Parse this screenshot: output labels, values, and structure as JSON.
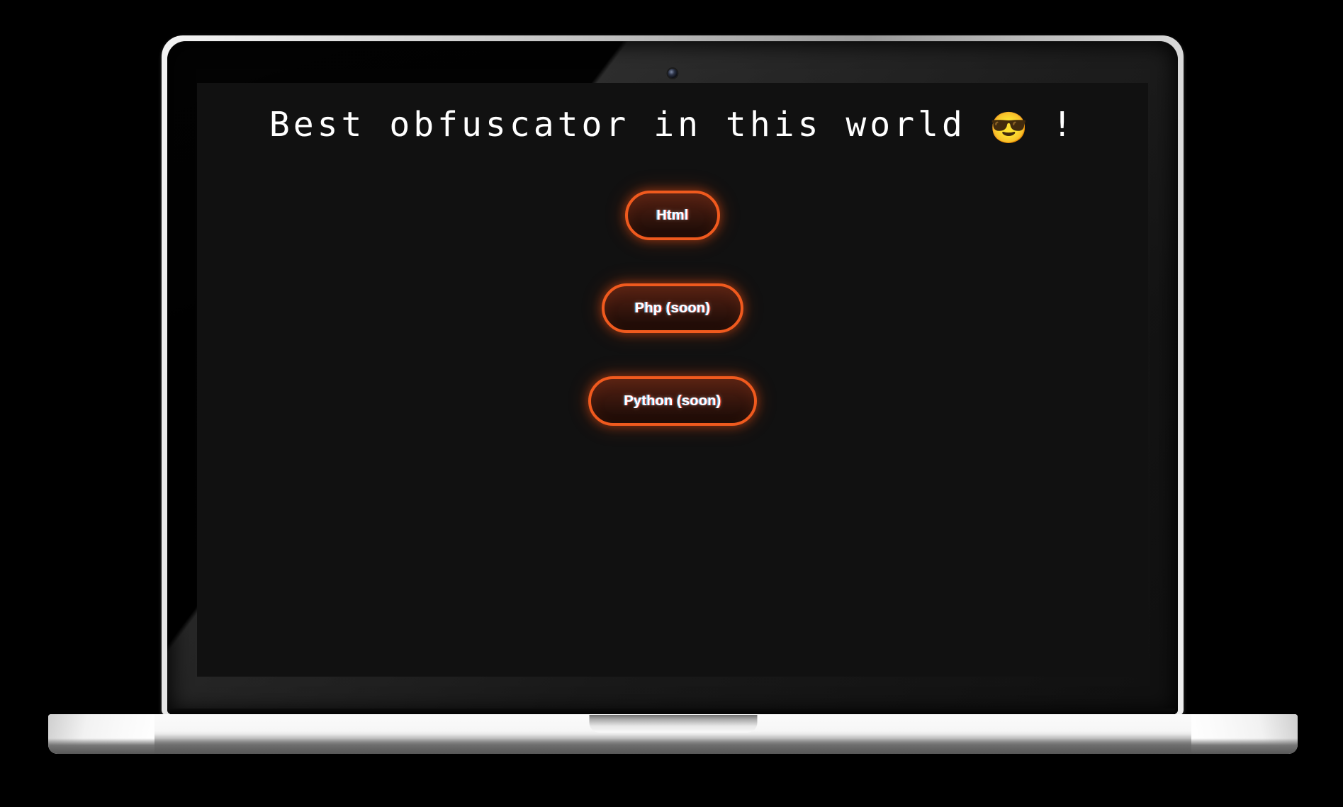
{
  "device": {
    "type": "laptop-mockup",
    "webcam": "webcam-dot",
    "screen_background": "#111111",
    "bezel_color": "#0d0d0d",
    "body_color": "#f2f2f2"
  },
  "screen": {
    "title": {
      "text_before_emoji": "Best obfuscator in this world ",
      "emoji": "😎",
      "text_after_emoji": " !",
      "full_text": "Best obfuscator in this world 😎 !",
      "color": "#ffffff"
    },
    "buttons": [
      {
        "label": "Html",
        "size": "sm",
        "state": "available"
      },
      {
        "label": "Php (soon)",
        "size": "md",
        "state": "coming-soon"
      },
      {
        "label": "Python (soon)",
        "size": "lg",
        "state": "coming-soon"
      }
    ],
    "button_style": {
      "border_color": "#f05a1e",
      "fill_top": "#512013",
      "fill_bottom": "#1b0a06",
      "glow_color": "#f05a1e",
      "label_color": "#ffffff"
    }
  }
}
